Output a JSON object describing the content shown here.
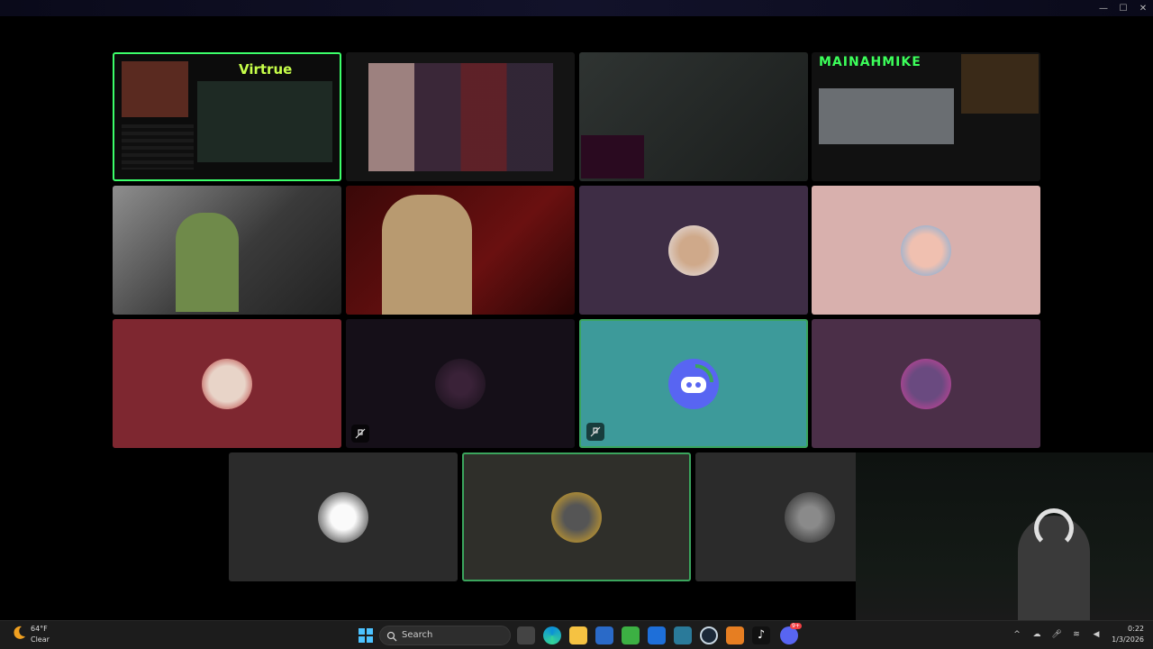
{
  "window": {
    "controls": [
      "minimize",
      "maximize",
      "close"
    ]
  },
  "stream_tiles": {
    "streamer1_brand": "Virtrue",
    "streamer4_brand": "MAINAHMIKE"
  },
  "participants": [
    {
      "id": "red-bg-user",
      "bg": "#7e2730",
      "speaking": false,
      "muted": false
    },
    {
      "id": "dark-logo-user",
      "bg": "#150f18",
      "speaking": false,
      "muted": true
    },
    {
      "id": "discord-user",
      "bg": "#3d9a9a",
      "speaking": true,
      "muted": true
    },
    {
      "id": "purple-pixel-user",
      "bg": "#4b2f48",
      "speaking": false,
      "muted": false
    },
    {
      "id": "purple-avatar-user",
      "bg": "#3e2d45",
      "speaking": false,
      "muted": false
    },
    {
      "id": "pink-avatar-user",
      "bg": "#d8b0ad",
      "speaking": false,
      "muted": false
    },
    {
      "id": "bw-avatar-user",
      "bg": "#2b2b2b",
      "speaking": false,
      "muted": false
    },
    {
      "id": "gold-avatar-user",
      "bg": "#2f2f2a",
      "speaking": true,
      "muted": false
    },
    {
      "id": "dark-hair-user",
      "bg": "#2b2b2b",
      "speaking": false,
      "muted": false
    }
  ],
  "taskbar": {
    "weather_temp": "64°F",
    "weather_cond": "Clear",
    "search_placeholder": "Search",
    "clock_time": "0:22",
    "clock_date": "1/3/2026",
    "discord_badge": "9+",
    "apps": [
      "windows-start",
      "search",
      "task-view",
      "edge",
      "file-explorer",
      "microsoft-store",
      "minecraft",
      "app-blue",
      "app-pkg",
      "steam",
      "app-orange",
      "tiktok",
      "discord"
    ]
  },
  "colors": {
    "speaking_border": "#3ba55d",
    "taskbar_bg": "#1c1c1c",
    "discord_blurple": "#5865f2"
  }
}
